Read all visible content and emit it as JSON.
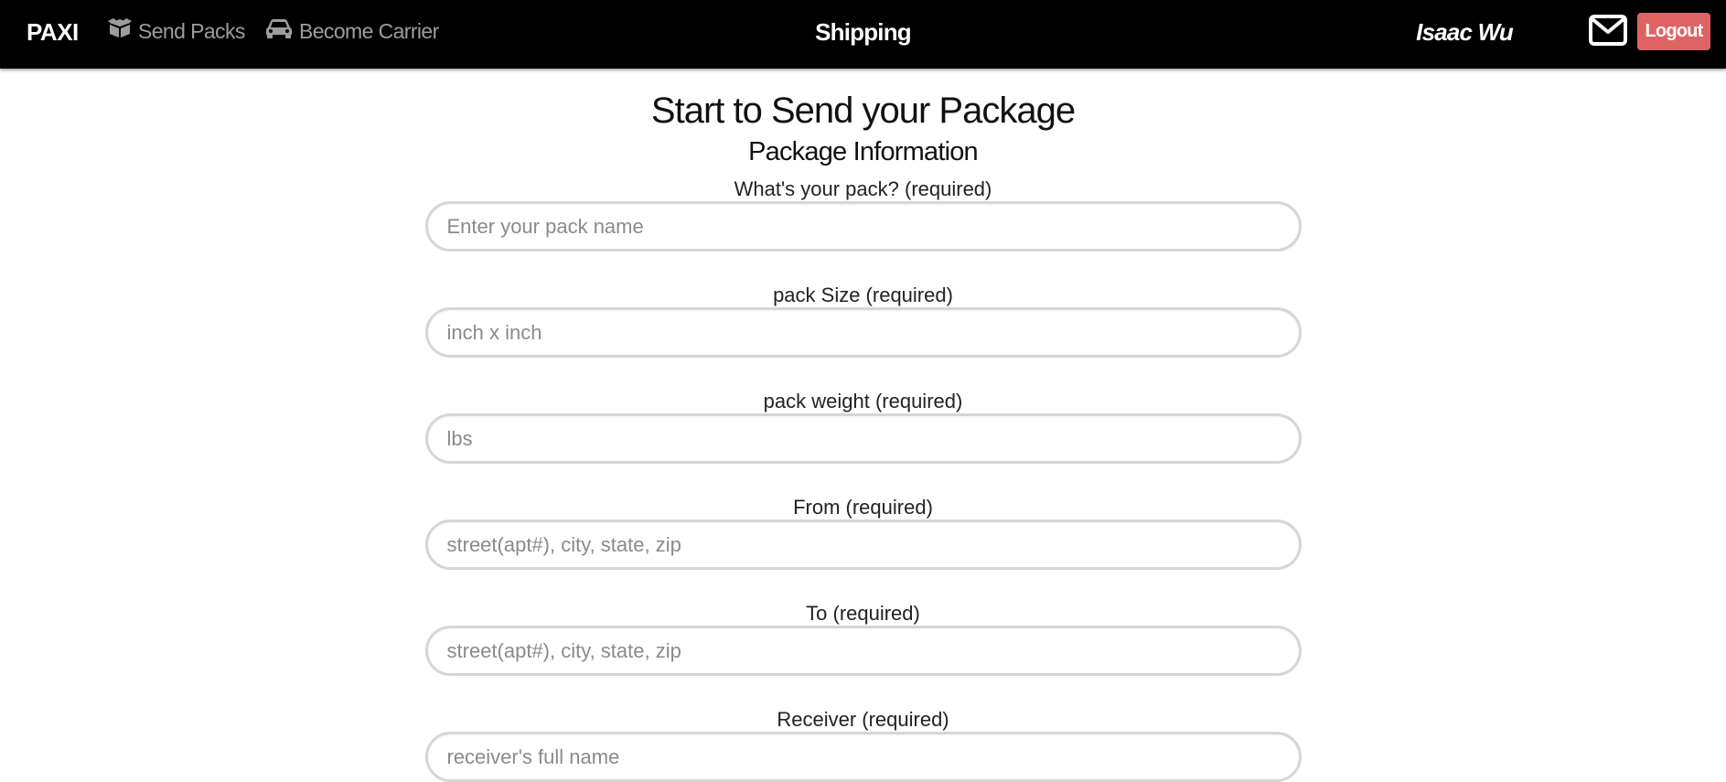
{
  "navbar": {
    "brand": "PAXI",
    "links": [
      {
        "label": "Send Packs",
        "icon": "box-icon"
      },
      {
        "label": "Become Carrier",
        "icon": "car-icon"
      }
    ],
    "page_heading": "Shipping",
    "username": "Isaac Wu",
    "mail_icon": "envelope-icon",
    "logout_label": "Logout"
  },
  "colors": {
    "navbar_bg": "#000000",
    "nav_link": "#9d9d9d",
    "logout_bg": "#e06363",
    "input_border": "#d6d6d6"
  },
  "main": {
    "title": "Start to Send your Package",
    "subtitle": "Package Information",
    "fields": [
      {
        "label": "What's your pack? (required)",
        "placeholder": "Enter your pack name",
        "value": ""
      },
      {
        "label": "pack Size (required)",
        "placeholder": "inch x inch",
        "value": ""
      },
      {
        "label": "pack weight (required)",
        "placeholder": "lbs",
        "value": ""
      },
      {
        "label": "From (required)",
        "placeholder": "street(apt#), city, state, zip",
        "value": ""
      },
      {
        "label": "To (required)",
        "placeholder": "street(apt#), city, state, zip",
        "value": ""
      },
      {
        "label": "Receiver (required)",
        "placeholder": "receiver's full name",
        "value": ""
      }
    ]
  }
}
